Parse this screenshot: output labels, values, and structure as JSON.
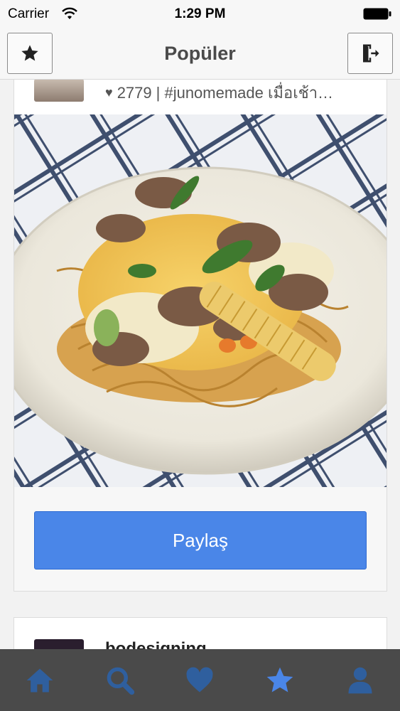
{
  "status_bar": {
    "carrier": "Carrier",
    "time": "1:29 PM"
  },
  "nav": {
    "title": "Popüler",
    "left_icon": "star-icon",
    "right_icon": "logout-icon"
  },
  "posts": [
    {
      "likes": "2779",
      "caption": "| #junomemade เมื่อเช้า…"
    },
    {
      "username": "bodesigning"
    }
  ],
  "share_label": "Paylaş",
  "tabs": [
    {
      "icon": "home-icon"
    },
    {
      "icon": "search-icon"
    },
    {
      "icon": "heart-icon"
    },
    {
      "icon": "star-icon",
      "active": true
    },
    {
      "icon": "profile-icon"
    }
  ],
  "colors": {
    "accent": "#4a86e8",
    "tab_bar": "#4a4a4a",
    "tab_inactive": "#2f5f9e",
    "tab_active": "#4a86e8"
  }
}
